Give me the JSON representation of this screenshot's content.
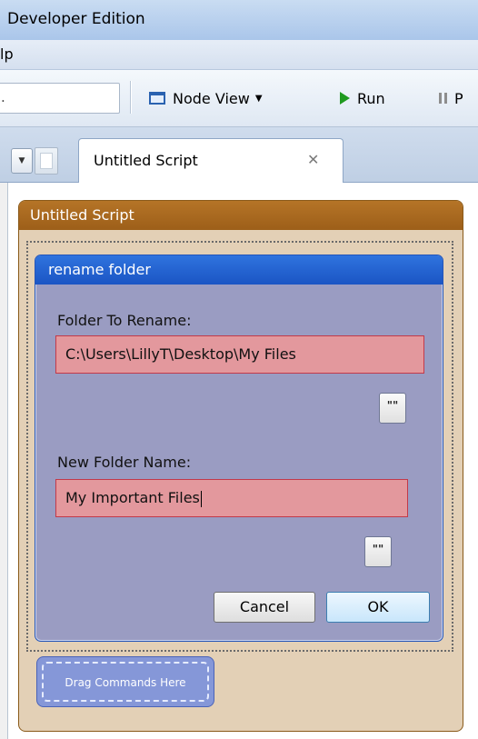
{
  "window": {
    "title": "Developer Edition"
  },
  "menubar": {
    "visible_item": "lp"
  },
  "toolbar": {
    "search_value": ".",
    "node_view_label": "Node View",
    "run_label": "Run",
    "pause_label": "P"
  },
  "tabs": [
    {
      "label": "Untitled Script",
      "close_glyph": "✕"
    }
  ],
  "script_panel": {
    "title": "Untitled Script"
  },
  "dialog": {
    "title": "rename folder",
    "fields": [
      {
        "label": "Folder To Rename:",
        "value": "C:\\Users\\LillyT\\Desktop\\My Files",
        "button_label": "\"\""
      },
      {
        "label": "New Folder Name:",
        "value": "My Important Files",
        "button_label": "\"\""
      }
    ],
    "cancel_label": "Cancel",
    "ok_label": "OK"
  },
  "drag_zone": {
    "label": "Drag Commands Here"
  },
  "colors": {
    "script_header": "#a86a21",
    "dialog_header": "#1f5fd0",
    "invalid_field": "#e3989d",
    "drag_zone": "#8597d8"
  }
}
